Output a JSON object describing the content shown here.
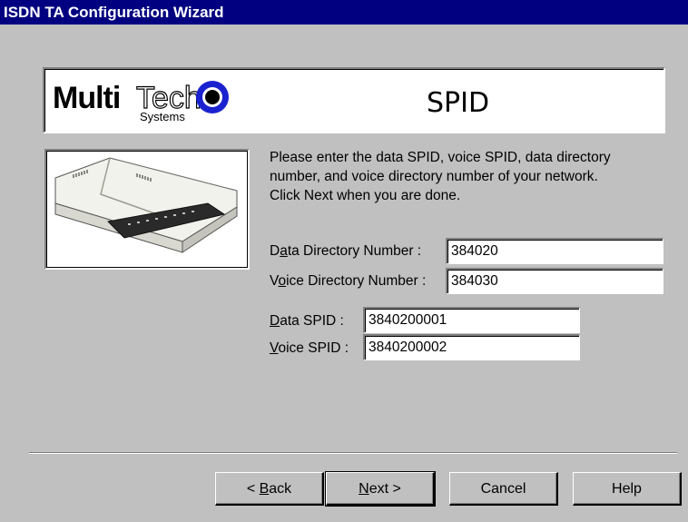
{
  "window": {
    "title": "ISDN TA Configuration Wizard"
  },
  "header": {
    "logo": {
      "word1": "Multi",
      "word2": "Tech",
      "sub": "Systems"
    },
    "title": "SPID"
  },
  "instructions": {
    "line1": "Please enter the data SPID, voice SPID, data directory",
    "line2": "number, and voice directory number of your network.",
    "line3": "Click Next when you are done."
  },
  "fields": {
    "data_dn": {
      "label_pre": "D",
      "label_acc": "a",
      "label_post": "ta Directory Number :",
      "value": "384020"
    },
    "voice_dn": {
      "label_pre": "V",
      "label_acc": "o",
      "label_post": "ice Directory Number :",
      "value": "384030"
    },
    "data_spid": {
      "label_pre": "",
      "label_acc": "D",
      "label_post": "ata SPID :",
      "value": "3840200001"
    },
    "voice_spid": {
      "label_pre": "",
      "label_acc": "V",
      "label_post": "oice SPID :",
      "value": "3840200002"
    }
  },
  "buttons": {
    "back": {
      "pre": "< ",
      "acc": "B",
      "post": "ack"
    },
    "next": {
      "pre": "",
      "acc": "N",
      "post": "ext >"
    },
    "cancel": "Cancel",
    "help": "Help"
  }
}
